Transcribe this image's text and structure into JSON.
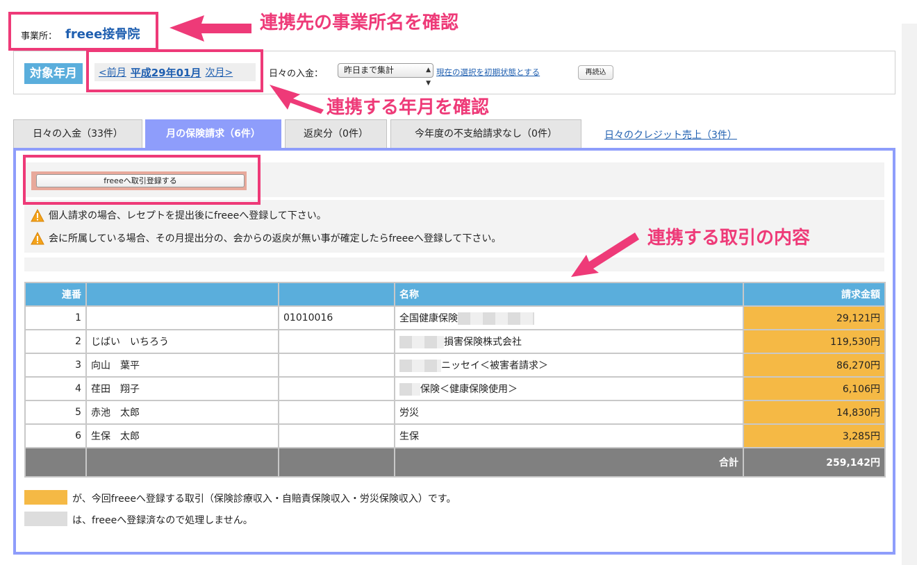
{
  "office": {
    "label": "事業所：",
    "name": "freee接骨院"
  },
  "annotations": {
    "confirm_office": "連携先の事業所名を確認",
    "confirm_period": "連携する年月を確認",
    "transaction_content": "連携する取引の内容"
  },
  "period": {
    "label": "対象年月",
    "prev": "<前月",
    "current": "平成29年01月",
    "next": "次月>"
  },
  "daily": {
    "label": "日々の入金：",
    "select_value": "昨日まで集計",
    "reset_link": "現在の選択を初期状態とする",
    "reload": "再読込"
  },
  "tabs": [
    {
      "label": "日々の入金（33件）",
      "active": false
    },
    {
      "label": "月の保険請求（6件）",
      "active": true
    },
    {
      "label": "返戻分（0件）",
      "active": false
    },
    {
      "label": "今年度の不支給請求なし（0件）",
      "active": false
    }
  ],
  "tab_link": "日々のクレジット売上（3件）",
  "register_button": "freeeへ取引登録する",
  "warnings": [
    "個人請求の場合、レセプトを提出後にfreeeへ登録して下さい。",
    "会に所属している場合、その月提出分の、会からの返戻が無い事が確定したらfreeeへ登録して下さい。"
  ],
  "table": {
    "headers": [
      "連番",
      "",
      "",
      "名称",
      "請求金額"
    ],
    "rows": [
      {
        "no": "1",
        "patient": "",
        "code": "01010016",
        "name": "全国健康保険",
        "amount": "29,121円"
      },
      {
        "no": "2",
        "patient": "じばい　いちろう",
        "code": "",
        "name": "損害保険株式会社",
        "amount": "119,530円"
      },
      {
        "no": "3",
        "patient": "向山　葉平",
        "code": "",
        "name": "ニッセイ＜被害者請求＞",
        "amount": "86,270円"
      },
      {
        "no": "4",
        "patient": "荏田　翔子",
        "code": "",
        "name": "保険＜健康保険使用＞",
        "amount": "6,106円"
      },
      {
        "no": "5",
        "patient": "赤池　太郎",
        "code": "",
        "name": "労災",
        "amount": "14,830円"
      },
      {
        "no": "6",
        "patient": "生保　太郎",
        "code": "",
        "name": "生保",
        "amount": "3,285円"
      }
    ],
    "total_label": "合計",
    "total_amount": "259,142円"
  },
  "legend": [
    {
      "color": "#f5b945",
      "text": "が、今回freeeへ登録する取引（保険診療収入・自賠責保険収入・労災保険収入）です。"
    },
    {
      "color": "#dddddd",
      "text": "は、freeeへ登録済なので処理しません。"
    }
  ],
  "colors": {
    "accent_pink": "#ee3a78",
    "tab_active": "#8e9dfb",
    "header_blue": "#5aaedc",
    "amount_orange": "#f5b945",
    "link": "#1f5fb0"
  }
}
